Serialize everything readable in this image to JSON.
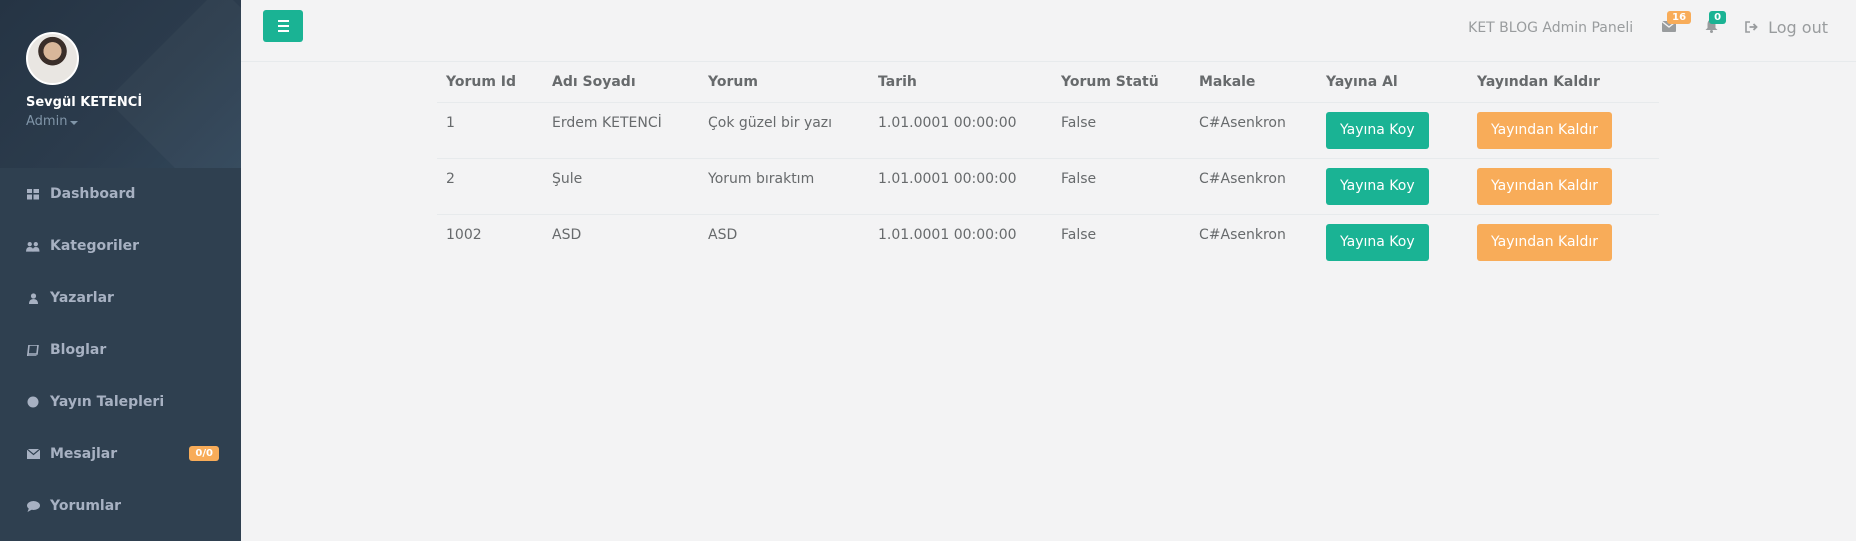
{
  "profile": {
    "name": "Sevgül KETENCİ",
    "role": "Admin"
  },
  "nav": [
    {
      "icon": "dashboard-icon",
      "glyph": "▦",
      "label": "Dashboard",
      "badge": ""
    },
    {
      "icon": "users-icon",
      "glyph": "👥",
      "label": "Kategoriler",
      "badge": ""
    },
    {
      "icon": "user-icon",
      "glyph": "●",
      "label": "Yazarlar",
      "badge": ""
    },
    {
      "icon": "book-icon",
      "glyph": "▭",
      "label": "Bloglar",
      "badge": ""
    },
    {
      "icon": "circle-icon",
      "glyph": "●",
      "label": "Yayın Talepleri",
      "badge": ""
    },
    {
      "icon": "envelope-icon",
      "glyph": "✉",
      "label": "Mesajlar",
      "badge": "0/0"
    },
    {
      "icon": "comment-icon",
      "glyph": "💬",
      "label": "Yorumlar",
      "badge": ""
    }
  ],
  "topbar": {
    "brand": "KET BLOG Admin Paneli",
    "messages_count": "16",
    "alerts_count": "0",
    "logout": "Log out"
  },
  "colors": {
    "primary": "#1ab394",
    "warning": "#f8ac59",
    "sidebar": "#2f4050"
  },
  "table": {
    "headers": [
      "Yorum Id",
      "Adı Soyadı",
      "Yorum",
      "Tarih",
      "Yorum Statü",
      "Makale",
      "Yayına Al",
      "Yayından Kaldır"
    ],
    "rows": [
      {
        "id": "1",
        "name": "Erdem KETENCİ",
        "comment": "Çok güzel bir yazı",
        "date": "1.01.0001 00:00:00",
        "status": "False",
        "article": "C#Asenkron",
        "publish": "Yayına Koy",
        "unpublish": "Yayından Kaldır"
      },
      {
        "id": "2",
        "name": "Şule",
        "comment": "Yorum bıraktım",
        "date": "1.01.0001 00:00:00",
        "status": "False",
        "article": "C#Asenkron",
        "publish": "Yayına Koy",
        "unpublish": "Yayından Kaldır"
      },
      {
        "id": "1002",
        "name": "ASD",
        "comment": "ASD",
        "date": "1.01.0001 00:00:00",
        "status": "False",
        "article": "C#Asenkron",
        "publish": "Yayına Koy",
        "unpublish": "Yayından Kaldır"
      }
    ]
  }
}
